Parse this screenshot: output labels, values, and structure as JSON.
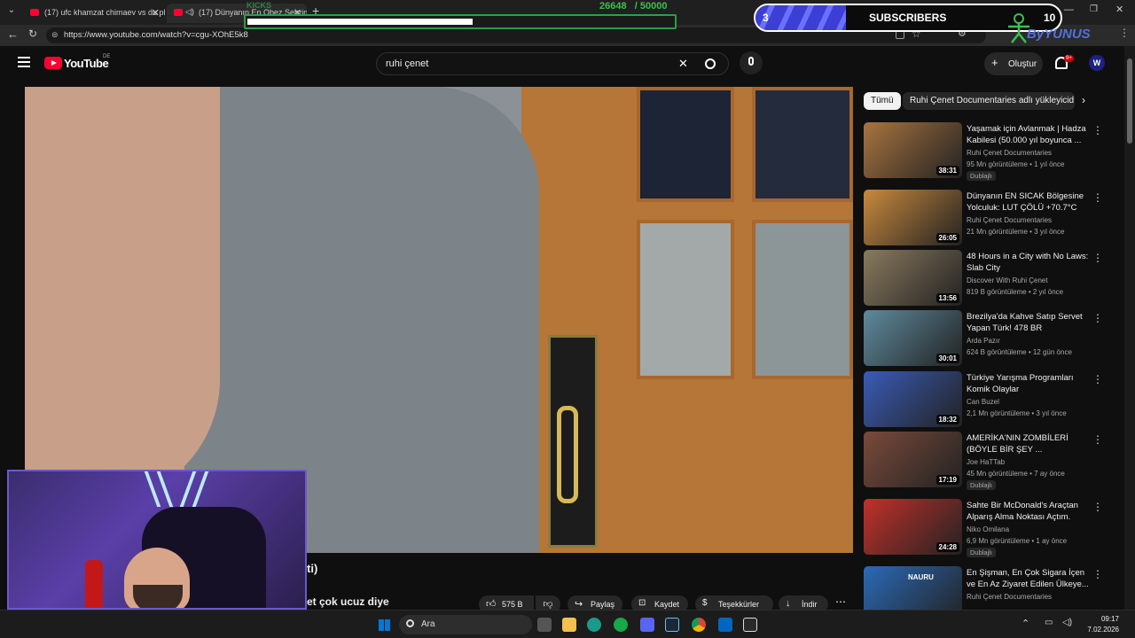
{
  "browser": {
    "tabs": [
      {
        "title": "(17) ufc khamzat chimaev vs du pl"
      },
      {
        "title": "(17) Dünyanın En Obez Şehrin"
      }
    ],
    "url": "https://www.youtube.com/watch?v=cgu-XOhE5k8"
  },
  "overlay": {
    "kicks_label": "KICKS",
    "counter_text": "26648   / 50000",
    "progress_fraction": 0.53,
    "subs_left": "3",
    "subs_label": "SUBSCRIBERS",
    "subs_right": "10",
    "brand_text": "ByYUNUS"
  },
  "youtube": {
    "logo_text": "YouTube",
    "region": "DE",
    "search_query": "ruhi çenet",
    "create_label": "Oluştur",
    "notif_count": "9+"
  },
  "video_info": {
    "title_fragment": "ti)",
    "desc_fragment": "et çok ucuz diye",
    "likes": "575 B",
    "share_label": "Paylaş",
    "save_label": "Kaydet",
    "thanks_label": "Teşekkürler",
    "download_label": "İndir"
  },
  "chips": [
    "Tümü",
    "Ruhi Çenet Documentaries adlı yükleyicid"
  ],
  "recommendations": [
    {
      "title": "Yaşamak için Avlanmak | Hadza Kabilesi (50.000 yıl boyunca ...",
      "channel": "Ruhi Çenet Documentaries",
      "meta": "95 Mn görüntüleme • 1 yıl önce",
      "duration": "38:31",
      "badge": "Dublajlı",
      "thumb_color": "#a8743f"
    },
    {
      "title": "Dünyanın EN SICAK Bölgesine Yolculuk: LUT ÇÖLÜ +70.7°C",
      "channel": "Ruhi Çenet Documentaries",
      "meta": "21 Mn görüntüleme • 3 yıl önce",
      "duration": "26:05",
      "badge": "",
      "thumb_color": "#c9893d"
    },
    {
      "title": "48 Hours in a City with No Laws: Slab City",
      "channel": "Discover With Ruhi Çenet",
      "meta": "819 B görüntüleme • 2 yıl önce",
      "duration": "13:56",
      "badge": "",
      "thumb_color": "#8a7a5e"
    },
    {
      "title": "Brezilya'da Kahve Satıp Servet Yapan Türk! 478 BR",
      "channel": "Arda Pazır",
      "meta": "624 B görüntüleme • 12 gün önce",
      "duration": "30:01",
      "badge": "",
      "thumb_color": "#5e8a9e"
    },
    {
      "title": "Türkiye Yarışma Programları Komik Olaylar",
      "channel": "Can Buzel",
      "meta": "2,1 Mn görüntüleme • 3 yıl önce",
      "duration": "18:32",
      "badge": "",
      "thumb_color": "#3a5bb8"
    },
    {
      "title": "AMERİKA'NIN ZOMBİLERİ (BÖYLE BİR ŞEY ...",
      "channel": "Joe HaTTab",
      "meta": "45 Mn görüntüleme • 7 ay önce",
      "duration": "17:19",
      "badge": "Dublajlı",
      "thumb_color": "#7a4a3a"
    },
    {
      "title": "Sahte Bir McDonald's Araçtan Alparış Alma Noktası Açtım.",
      "channel": "Niko Omilana",
      "meta": "6,9 Mn görüntüleme • 1 ay önce",
      "duration": "24:28",
      "badge": "Dublajlı",
      "thumb_color": "#c2302a"
    },
    {
      "title": "En Şişman, En Çok Sigara İçen ve En Az Ziyaret Edilen Ülkeye...",
      "channel": "Ruhi Çenet Documentaries",
      "meta": "",
      "duration": "",
      "badge": "",
      "thumb_color": "#2a6ab8",
      "thumb_text": "NAURU"
    }
  ],
  "taskbar": {
    "search_label": "Ara",
    "time": "09:17",
    "date": "7.02.2026"
  }
}
